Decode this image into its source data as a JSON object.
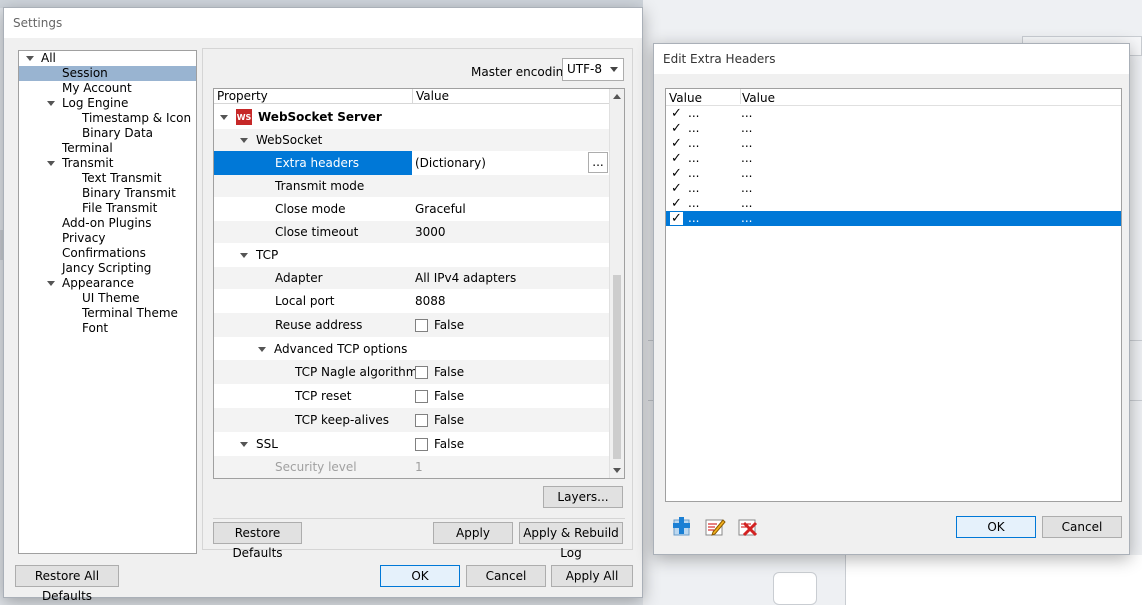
{
  "settings": {
    "title": "Settings",
    "tree": [
      {
        "label": "All",
        "depth": 0,
        "expanded": true
      },
      {
        "label": "Session",
        "depth": 1,
        "selected": true
      },
      {
        "label": "My Account",
        "depth": 1
      },
      {
        "label": "Log Engine",
        "depth": 1,
        "expanded": true
      },
      {
        "label": "Timestamp & Icon",
        "depth": 2
      },
      {
        "label": "Binary Data",
        "depth": 2
      },
      {
        "label": "Terminal",
        "depth": 1
      },
      {
        "label": "Transmit",
        "depth": 1,
        "expanded": true
      },
      {
        "label": "Text Transmit",
        "depth": 2
      },
      {
        "label": "Binary Transmit",
        "depth": 2
      },
      {
        "label": "File Transmit",
        "depth": 2
      },
      {
        "label": "Add-on Plugins",
        "depth": 1
      },
      {
        "label": "Privacy",
        "depth": 1
      },
      {
        "label": "Confirmations",
        "depth": 1
      },
      {
        "label": "Jancy Scripting",
        "depth": 1
      },
      {
        "label": "Appearance",
        "depth": 1,
        "expanded": true
      },
      {
        "label": "UI Theme",
        "depth": 2
      },
      {
        "label": "Terminal Theme",
        "depth": 2
      },
      {
        "label": "Font",
        "depth": 2
      }
    ],
    "master_encoding_label": "Master encoding:",
    "master_encoding_value": "UTF-8",
    "grid": {
      "col_property": "Property",
      "col_value": "Value",
      "rows": [
        {
          "name": "WebSocket Server",
          "depth": 0,
          "group": true,
          "bold": true,
          "expanded": true,
          "icon": "websocket-server-icon",
          "icon_text": "WS",
          "value": ""
        },
        {
          "name": "WebSocket",
          "depth": 1,
          "group": true,
          "expanded": true,
          "value": ""
        },
        {
          "name": "Extra headers",
          "depth": 2,
          "value": "(Dictionary)",
          "selected": true,
          "ellipsis_button": "..."
        },
        {
          "name": "Transmit mode",
          "depth": 2,
          "value": ""
        },
        {
          "name": "Close mode",
          "depth": 2,
          "value": "Graceful"
        },
        {
          "name": "Close timeout",
          "depth": 2,
          "value": "3000"
        },
        {
          "name": "TCP",
          "depth": 1,
          "group": true,
          "expanded": true,
          "value": ""
        },
        {
          "name": "Adapter",
          "depth": 2,
          "value": "All IPv4 adapters"
        },
        {
          "name": "Local port",
          "depth": 2,
          "value": "8088"
        },
        {
          "name": "Reuse address",
          "depth": 2,
          "checkbox": true,
          "value": "False"
        },
        {
          "name": "Advanced TCP options",
          "depth": 2,
          "group": true,
          "expanded": true,
          "value": ""
        },
        {
          "name": "TCP Nagle algorithm",
          "depth": 3,
          "checkbox": true,
          "value": "False"
        },
        {
          "name": "TCP reset",
          "depth": 3,
          "checkbox": true,
          "value": "False"
        },
        {
          "name": "TCP keep-alives",
          "depth": 3,
          "checkbox": true,
          "value": "False"
        },
        {
          "name": "SSL",
          "depth": 1,
          "group": true,
          "expanded": true,
          "checkbox": true,
          "value": "False"
        },
        {
          "name": "Security level",
          "depth": 2,
          "disabled": true,
          "value": "1"
        }
      ]
    },
    "buttons": {
      "layers": "Layers...",
      "restore_defaults": "Restore Defaults",
      "apply": "Apply",
      "apply_rebuild_log": "Apply & Rebuild Log",
      "restore_all_defaults": "Restore All Defaults",
      "ok": "OK",
      "cancel": "Cancel",
      "apply_all": "Apply All"
    }
  },
  "extra_headers": {
    "title": "Edit Extra Headers",
    "col1": "Value",
    "col2": "Value",
    "rows": [
      {
        "checked": true,
        "key": "...",
        "value": "..."
      },
      {
        "checked": true,
        "key": "...",
        "value": "..."
      },
      {
        "checked": true,
        "key": "...",
        "value": "..."
      },
      {
        "checked": true,
        "key": "...",
        "value": "..."
      },
      {
        "checked": true,
        "key": "...",
        "value": "..."
      },
      {
        "checked": true,
        "key": "...",
        "value": "..."
      },
      {
        "checked": true,
        "key": "...",
        "value": "..."
      },
      {
        "checked": true,
        "key": "...",
        "value": "...",
        "selected": true
      }
    ],
    "checkmark": "✓",
    "icons": [
      "add-icon",
      "edit-icon",
      "delete-icon"
    ],
    "buttons": {
      "ok": "OK",
      "cancel": "Cancel"
    }
  }
}
